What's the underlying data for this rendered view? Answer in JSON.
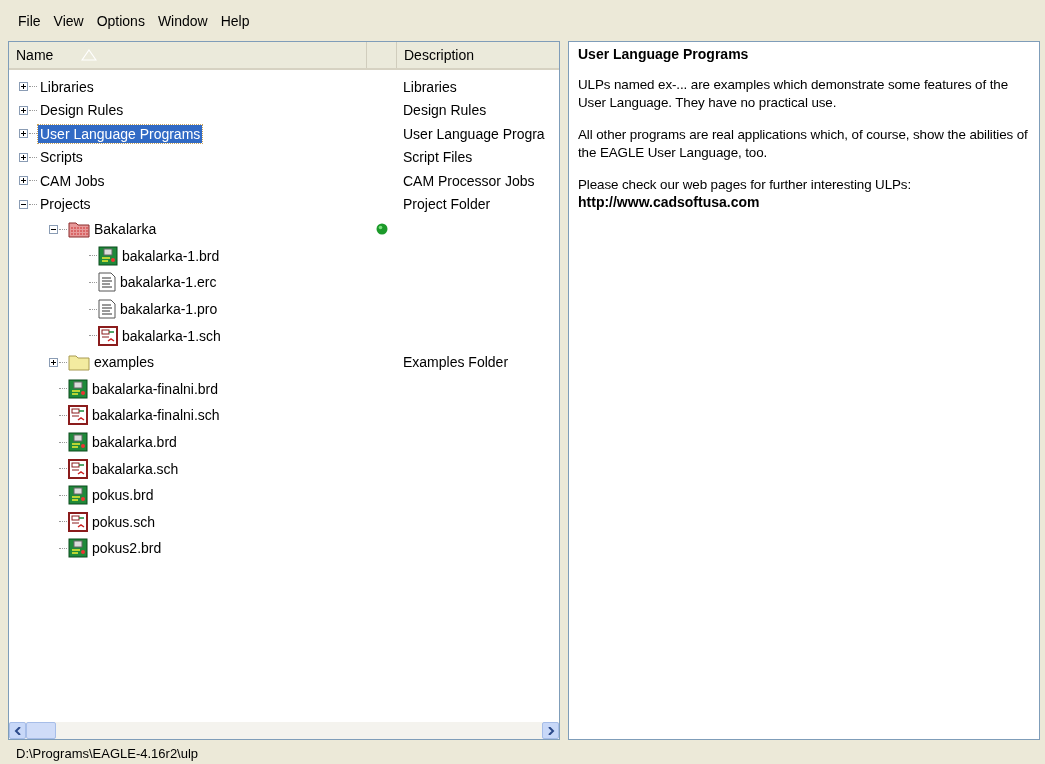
{
  "menu": [
    "File",
    "View",
    "Options",
    "Window",
    "Help"
  ],
  "columns": [
    "Name",
    "Description"
  ],
  "tree": [
    {
      "name": "Libraries",
      "description": "Libraries",
      "expanded": false,
      "selected": false
    },
    {
      "name": "Design Rules",
      "description": "Design Rules",
      "expanded": false,
      "selected": false
    },
    {
      "name": "User Language Programs",
      "description": "User Language Progra",
      "expanded": false,
      "selected": true
    },
    {
      "name": "Scripts",
      "description": "Script Files",
      "expanded": false,
      "selected": false
    },
    {
      "name": "CAM Jobs",
      "description": "CAM Processor Jobs",
      "expanded": false,
      "selected": false
    },
    {
      "name": "Projects",
      "description": "Project Folder",
      "expanded": true,
      "selected": false,
      "children": [
        {
          "name": "Bakalarka",
          "kind": "project",
          "expanded": true,
          "selected": false,
          "active": true,
          "children": [
            {
              "name": "bakalarka-1.brd",
              "kind": "board",
              "selected": false
            },
            {
              "name": "bakalarka-1.erc",
              "kind": "text",
              "selected": false
            },
            {
              "name": "bakalarka-1.pro",
              "kind": "text",
              "selected": false
            },
            {
              "name": "bakalarka-1.sch",
              "kind": "schematic",
              "selected": false
            }
          ]
        },
        {
          "name": "examples",
          "kind": "folder",
          "description": "Examples Folder",
          "expanded": false,
          "selected": false
        },
        {
          "name": "bakalarka-finalni.brd",
          "kind": "board",
          "selected": false
        },
        {
          "name": "bakalarka-finalni.sch",
          "kind": "schematic",
          "selected": false
        },
        {
          "name": "bakalarka.brd",
          "kind": "board",
          "selected": false
        },
        {
          "name": "bakalarka.sch",
          "kind": "schematic",
          "selected": false
        },
        {
          "name": "pokus.brd",
          "kind": "board",
          "selected": false
        },
        {
          "name": "pokus.sch",
          "kind": "schematic",
          "selected": false
        },
        {
          "name": "pokus2.brd",
          "kind": "board",
          "selected": false
        }
      ]
    }
  ],
  "info": {
    "title": "User Language Programs",
    "paragraphs": [
      "ULPs named ex-... are examples which demonstrate some features of the User Language. They have no practical use.",
      "All other programs are real applications which, of course, show the abilities of the EAGLE User Language, too.",
      "Please check our web pages for further interesting ULPs:"
    ],
    "link": "http://www.cadsoftusa.com"
  },
  "status_bar": "D:\\Programs\\EAGLE-4.16r2\\ulp"
}
